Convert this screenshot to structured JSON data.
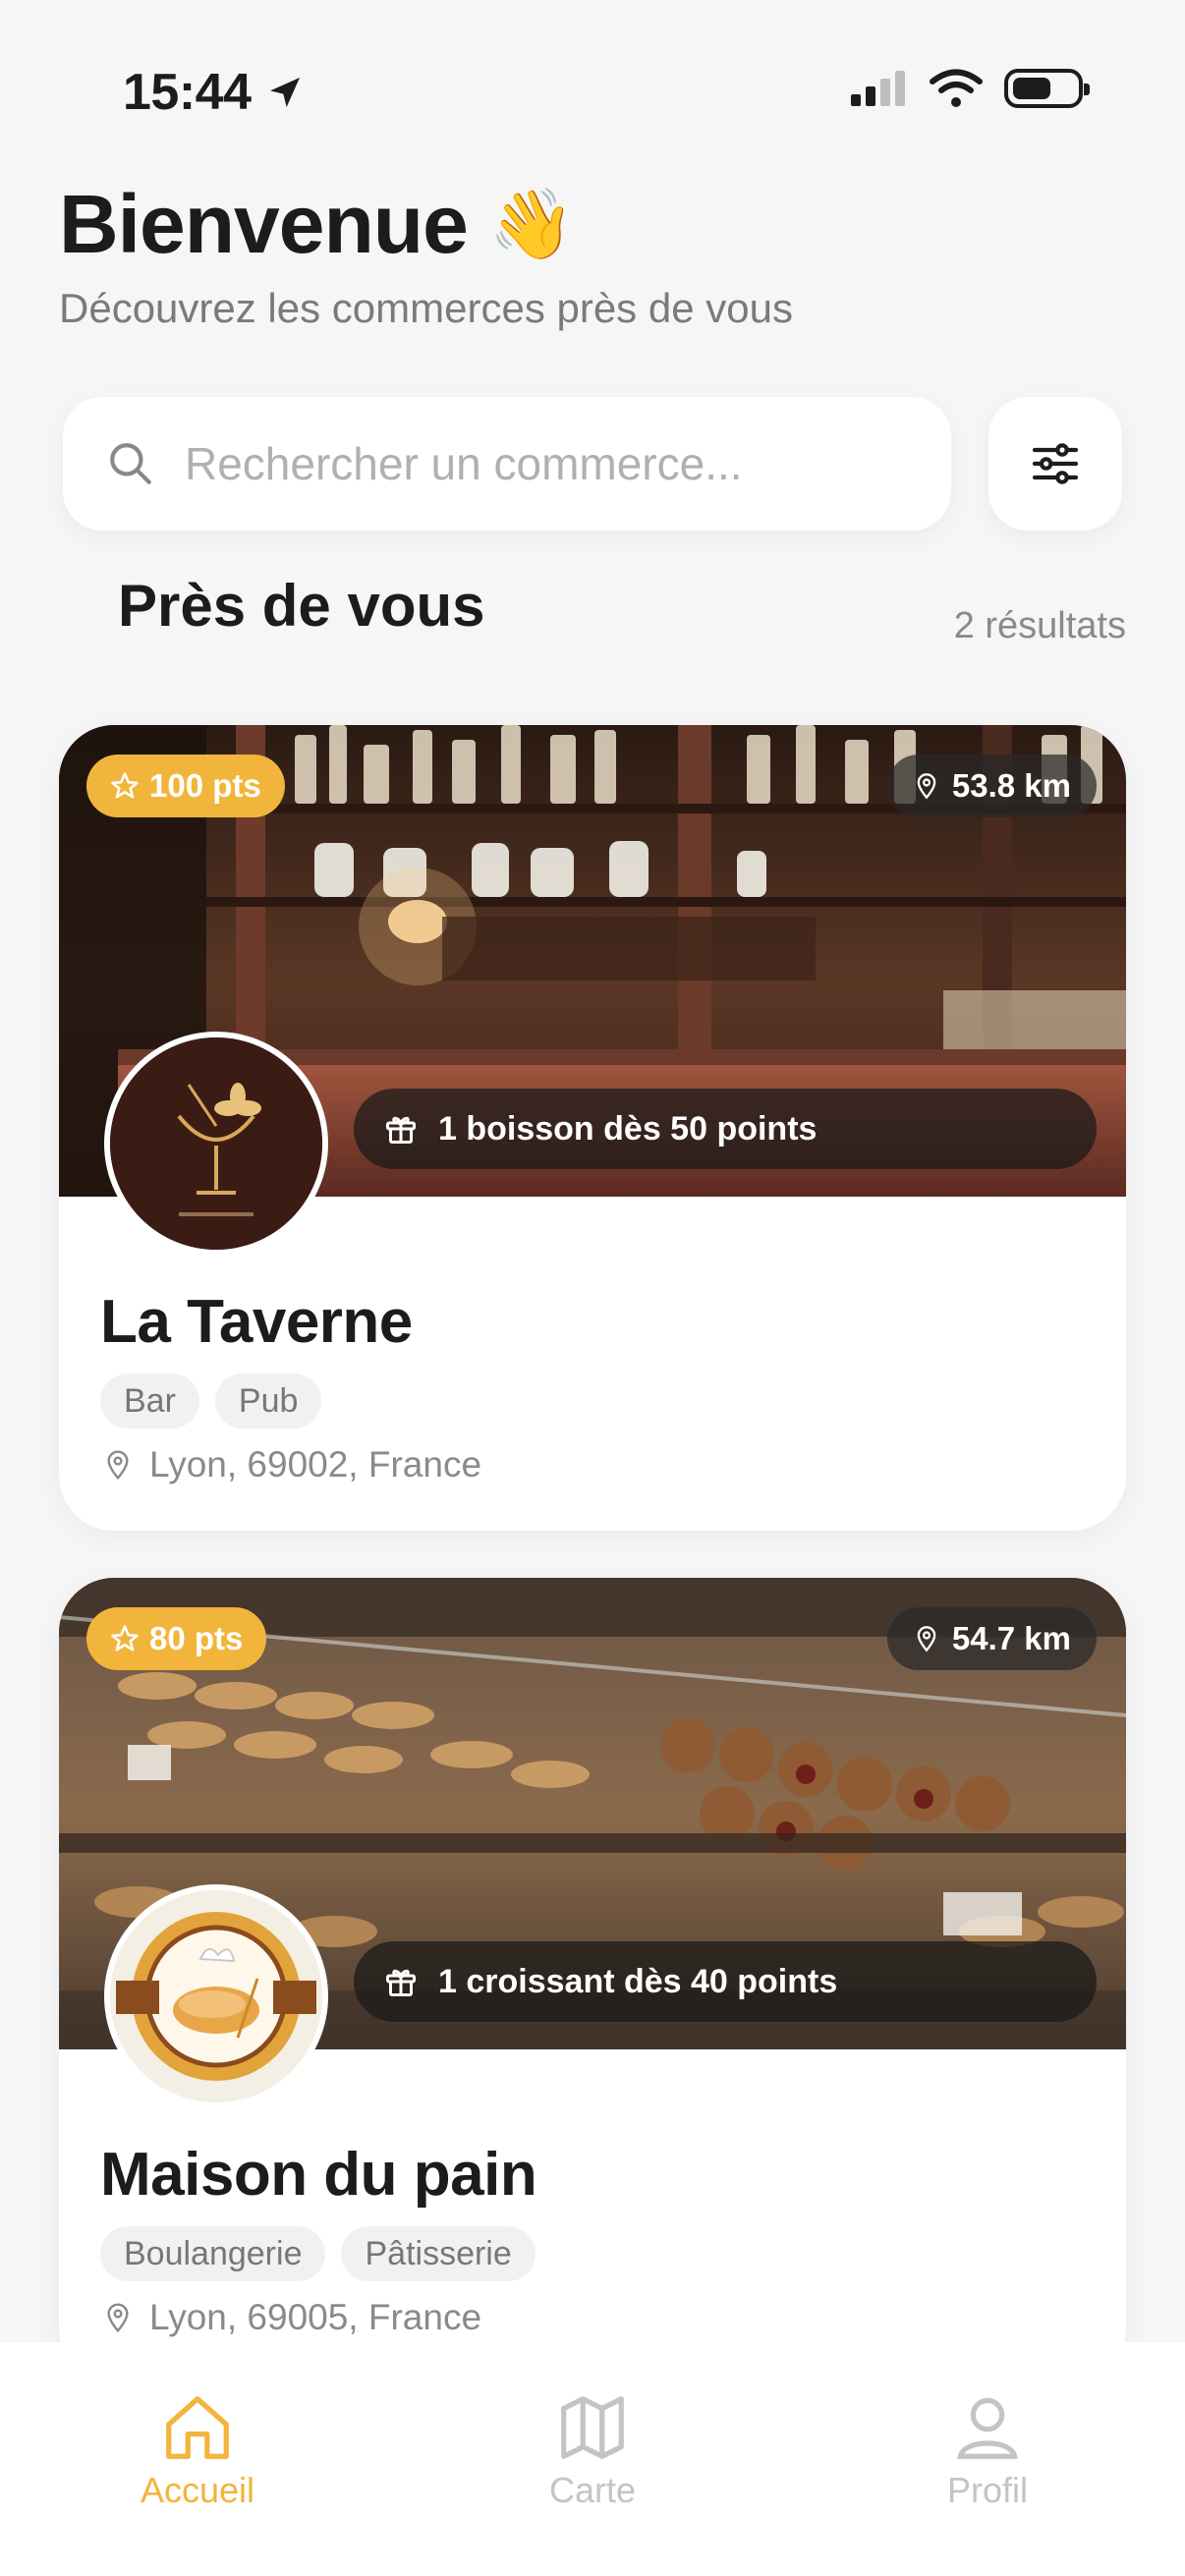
{
  "status_bar": {
    "time": "15:44"
  },
  "header": {
    "greeting": "Bienvenue",
    "greeting_emoji": "👋",
    "subtitle": "Découvrez les commerces près de vous"
  },
  "search": {
    "placeholder": "Rechercher un commerce..."
  },
  "section": {
    "title": "Près de vous",
    "result_count": "2 résultats"
  },
  "colors": {
    "accent": "#f2b53b",
    "tag_bg": "#f1f1f1",
    "muted_text": "#8a8a8a"
  },
  "businesses": [
    {
      "points": "100 pts",
      "distance": "53.8 km",
      "reward": "1 boisson dès 50 points",
      "name": "La Taverne",
      "tags": [
        "Bar",
        "Pub"
      ],
      "address": "Lyon, 69002, France",
      "image": "bar-interior-photo",
      "logo": "cocktail-glass-logo"
    },
    {
      "points": "80 pts",
      "distance": "54.7 km",
      "reward": "1 croissant  dès 40 points",
      "name": "Maison du pain",
      "tags": [
        "Boulangerie",
        "Pâtisserie"
      ],
      "address": "Lyon, 69005, France",
      "image": "bakery-display-photo",
      "logo": "bread-badge-logo"
    }
  ],
  "tab_bar": {
    "items": [
      {
        "label": "Accueil",
        "icon": "home-icon",
        "active": true
      },
      {
        "label": "Carte",
        "icon": "map-icon",
        "active": false
      },
      {
        "label": "Profil",
        "icon": "profile-icon",
        "active": false
      }
    ]
  }
}
